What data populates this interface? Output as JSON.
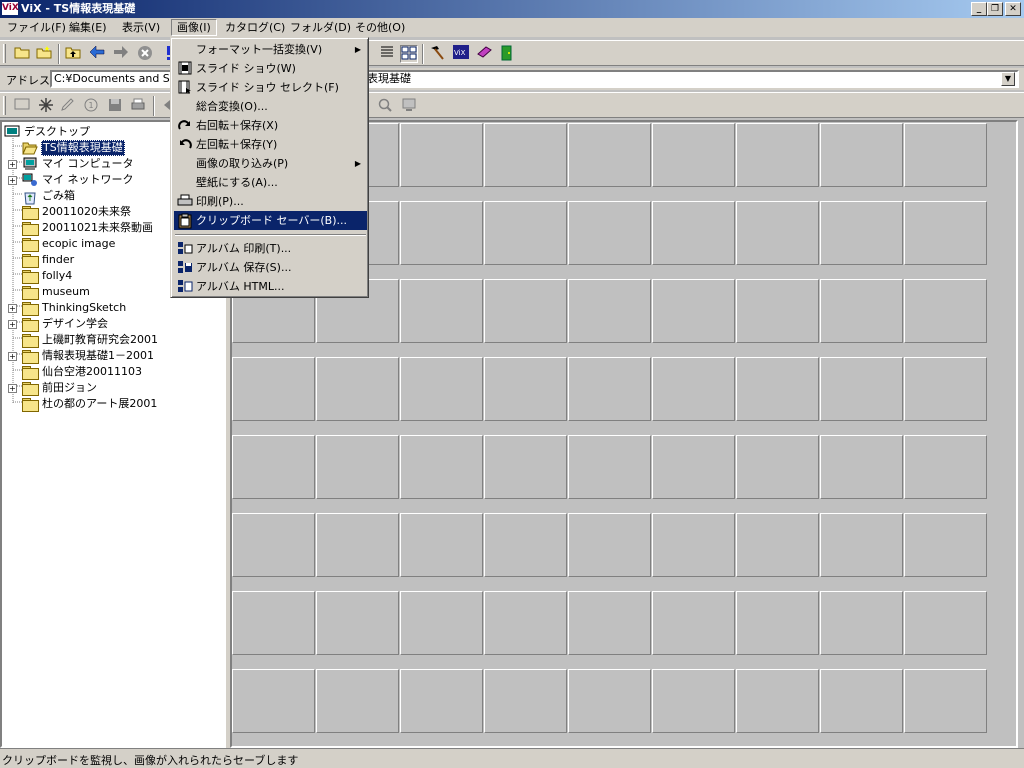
{
  "window": {
    "logo_text": "ViX",
    "title": "ViX - TS情報表現基礎",
    "buttons": {
      "minimize": "_",
      "restore": "❐",
      "close": "✕"
    }
  },
  "menubar": [
    {
      "label": "ファイル(F)"
    },
    {
      "label": "編集(E)"
    },
    {
      "label": "表示(V)"
    },
    {
      "label": "画像(I)",
      "active": true
    },
    {
      "label": "カタログ(C)"
    },
    {
      "label": "フォルダ(D)"
    },
    {
      "label": "その他(O)"
    }
  ],
  "address": {
    "label": "アドレス",
    "value_left": "C:¥Documents and Sett",
    "value_right": "表現基礎"
  },
  "tree": {
    "items": [
      {
        "label": "デスクトップ",
        "icon": "desktop-icon",
        "level": 0,
        "expander": ""
      },
      {
        "label": "TS情報表現基礎",
        "icon": "folder-open-icon",
        "level": 1,
        "expander": "",
        "selected": true
      },
      {
        "label": "マイ コンピュータ",
        "icon": "computer-icon",
        "level": 1,
        "expander": "+"
      },
      {
        "label": "マイ ネットワーク",
        "icon": "network-icon",
        "level": 1,
        "expander": "+"
      },
      {
        "label": "ごみ箱",
        "icon": "recycle-bin-icon",
        "level": 1,
        "expander": ""
      },
      {
        "label": "20011020未来祭",
        "icon": "folder-icon",
        "level": 1,
        "expander": ""
      },
      {
        "label": "20011021未来祭動画",
        "icon": "folder-icon",
        "level": 1,
        "expander": ""
      },
      {
        "label": "ecopic image",
        "icon": "folder-icon",
        "level": 1,
        "expander": ""
      },
      {
        "label": "finder",
        "icon": "folder-icon",
        "level": 1,
        "expander": ""
      },
      {
        "label": "folly4",
        "icon": "folder-icon",
        "level": 1,
        "expander": ""
      },
      {
        "label": "museum",
        "icon": "folder-icon",
        "level": 1,
        "expander": ""
      },
      {
        "label": "ThinkingSketch",
        "icon": "folder-icon",
        "level": 1,
        "expander": "+"
      },
      {
        "label": "デザイン学会",
        "icon": "folder-icon",
        "level": 1,
        "expander": "+"
      },
      {
        "label": "上磯町教育研究会2001",
        "icon": "folder-icon",
        "level": 1,
        "expander": ""
      },
      {
        "label": "情報表現基礎1－2001",
        "icon": "folder-icon",
        "level": 1,
        "expander": "+"
      },
      {
        "label": "仙台空港20011103",
        "icon": "folder-icon",
        "level": 1,
        "expander": ""
      },
      {
        "label": "前田ジョン",
        "icon": "folder-icon",
        "level": 1,
        "expander": "+"
      },
      {
        "label": "杜の都のアート展2001",
        "icon": "folder-icon",
        "level": 1,
        "expander": ""
      }
    ]
  },
  "image_menu": {
    "items": [
      {
        "label": "フォーマット一括変換(V)",
        "icon": "",
        "submenu": true
      },
      {
        "label": "スライド ショウ(W)",
        "icon": "film-icon"
      },
      {
        "label": "スライド ショウ セレクト(F)",
        "icon": "film-select-icon"
      },
      {
        "label": "総合変換(O)...",
        "icon": ""
      },
      {
        "label": "右回転＋保存(X)",
        "icon": "rotate-right-icon"
      },
      {
        "label": "左回転＋保存(Y)",
        "icon": "rotate-left-icon"
      },
      {
        "label": "画像の取り込み(P)",
        "icon": "",
        "submenu": true
      },
      {
        "label": "壁紙にする(A)...",
        "icon": ""
      },
      {
        "label": "印刷(P)...",
        "icon": "printer-icon"
      },
      {
        "label": "クリップボード セーバー(B)...",
        "icon": "clipboard-icon",
        "highlighted": true
      },
      {
        "separator": true
      },
      {
        "label": "アルバム 印刷(T)...",
        "icon": "album-print-icon"
      },
      {
        "label": "アルバム 保存(S)...",
        "icon": "album-save-icon"
      },
      {
        "label": "アルバム HTML...",
        "icon": "album-html-icon"
      }
    ]
  },
  "thumbnail_grid": {
    "rows": 8,
    "cols": 9
  },
  "statusbar": {
    "text": "クリップボードを監視し、画像が入れられたらセーブします"
  },
  "colors": {
    "selection": "#0a246a",
    "face": "#d4d0c8"
  }
}
